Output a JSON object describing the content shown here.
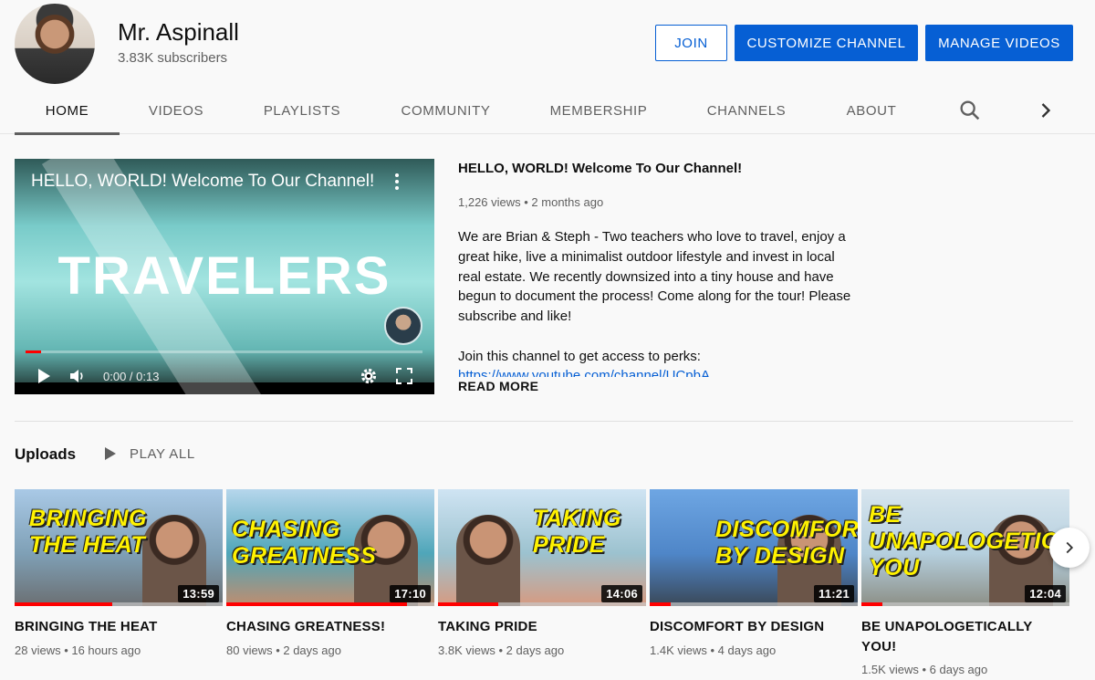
{
  "channel": {
    "name": "Mr. Aspinall",
    "subscribers": "3.83K subscribers"
  },
  "buttons": {
    "join": "JOIN",
    "customize": "CUSTOMIZE CHANNEL",
    "manage": "MANAGE VIDEOS"
  },
  "tabs": [
    {
      "label": "HOME",
      "active": true
    },
    {
      "label": "VIDEOS"
    },
    {
      "label": "PLAYLISTS"
    },
    {
      "label": "COMMUNITY"
    },
    {
      "label": "MEMBERSHIP"
    },
    {
      "label": "CHANNELS"
    },
    {
      "label": "ABOUT"
    }
  ],
  "icons": {
    "search": "search-icon",
    "chevron_right": "chevron-right-icon",
    "play": "play-icon",
    "volume": "volume-icon",
    "settings": "gear-icon",
    "fullscreen": "fullscreen-icon",
    "more": "more-vert-icon"
  },
  "featured": {
    "player_title": "HELLO, WORLD! Welcome To Our Channel!",
    "thumbnail_word": "TRAVELERS",
    "time": "0:00 / 0:13",
    "progress_fraction": 0.04,
    "title": "HELLO, WORLD! Welcome To Our Channel!",
    "meta": "1,226 views • 2 months ago",
    "description": "We are Brian & Steph - Two teachers who love to travel, enjoy a great hike, live a minimalist outdoor lifestyle and invest in local real estate. We recently downsized into a tiny house and have begun to document the process! Come along for the tour! Please subscribe and like!",
    "perks_line": "Join this channel to get access to perks:",
    "link": "https://www.youtube.com/channel/UCpbA",
    "read_more": "READ MORE"
  },
  "uploads": {
    "heading": "Uploads",
    "play_all": "PLAY ALL",
    "videos": [
      {
        "title": "BRINGING THE HEAT",
        "thumb_text": "BRINGING THE HEAT",
        "duration": "13:59",
        "meta": "28 views • 16 hours ago",
        "watched": 0.47,
        "colors": [
          "#a9c9e6",
          "#7fa0b6",
          "#6b6f72"
        ]
      },
      {
        "title": "CHASING GREATNESS!",
        "thumb_text": "CHASING GREATNESS",
        "duration": "17:10",
        "meta": "80 views • 2 days ago",
        "watched": 0.87,
        "colors": [
          "#b6d6ec",
          "#4fa6b9",
          "#c08d6e"
        ]
      },
      {
        "title": "TAKING PRIDE",
        "thumb_text": "TAKING PRIDE",
        "duration": "14:06",
        "meta": "3.8K views • 2 days ago",
        "watched": 0.29,
        "colors": [
          "#cfe4f3",
          "#9cc2cf",
          "#d79a80"
        ]
      },
      {
        "title": "DISCOMFORT BY DESIGN",
        "thumb_text": "DISCOMFORT BY DESIGN",
        "duration": "11:21",
        "meta": "1.4K views • 4 days ago",
        "watched": 0.1,
        "colors": [
          "#6ea6e3",
          "#4f86c8",
          "#3a4858"
        ]
      },
      {
        "title": "BE UNAPOLOGETICALLY YOU!",
        "thumb_text": "BE UNAPOLOGETICALLY YOU",
        "duration": "12:04",
        "meta": "1.5K views • 6 days ago",
        "watched": 0.1,
        "colors": [
          "#d7e5ee",
          "#b5cfde",
          "#8c8f86"
        ]
      }
    ]
  }
}
